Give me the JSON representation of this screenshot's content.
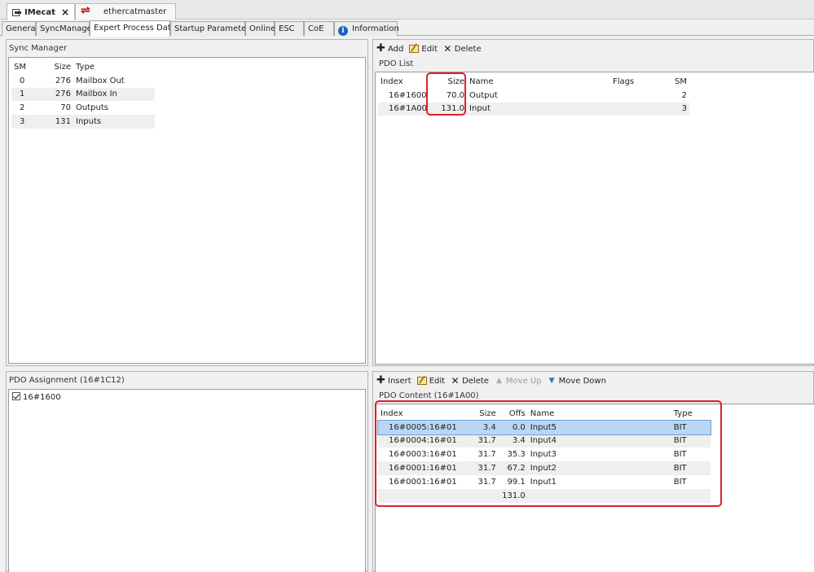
{
  "doc_tabs": [
    {
      "label": "IMecat",
      "active": true
    },
    {
      "label": "ethercatmaster",
      "active": false
    }
  ],
  "editor_tabs": [
    "General",
    "SyncManager",
    "Expert Process Data",
    "Startup Parameters",
    "Online",
    "ESC",
    "CoE",
    "Information"
  ],
  "active_editor_tab": "Expert Process Data",
  "sync_manager": {
    "title": "Sync Manager",
    "headers": [
      "SM",
      "Size",
      "Type"
    ],
    "rows": [
      [
        "0",
        "276",
        "Mailbox Out"
      ],
      [
        "1",
        "276",
        "Mailbox In"
      ],
      [
        "2",
        "70",
        "Outputs"
      ],
      [
        "3",
        "131",
        "Inputs"
      ]
    ]
  },
  "pdo_list": {
    "toolbar": {
      "add": "Add",
      "edit": "Edit",
      "delete": "Delete"
    },
    "title": "PDO List",
    "headers": [
      "Index",
      "Size",
      "Name",
      "Flags",
      "SM"
    ],
    "rows": [
      [
        "16#1600",
        "70.0",
        "Output",
        "",
        "2"
      ],
      [
        "16#1A00",
        "131.0",
        "Input",
        "",
        "3"
      ]
    ]
  },
  "pdo_assignment": {
    "title": "PDO Assignment (16#1C12)",
    "items": [
      {
        "label": "16#1600",
        "checked": true
      }
    ]
  },
  "pdo_content": {
    "toolbar": {
      "insert": "Insert",
      "edit": "Edit",
      "delete": "Delete",
      "move_up": "Move Up",
      "move_down": "Move Down"
    },
    "title": "PDO Content (16#1A00)",
    "headers": [
      "Index",
      "Size",
      "Offs",
      "Name",
      "Type"
    ],
    "rows": [
      [
        "16#0005:16#01",
        "3.4",
        "0.0",
        "Input5",
        "BIT"
      ],
      [
        "16#0004:16#01",
        "31.7",
        "3.4",
        "Input4",
        "BIT"
      ],
      [
        "16#0003:16#01",
        "31.7",
        "35.3",
        "Input3",
        "BIT"
      ],
      [
        "16#0001:16#01",
        "31.7",
        "67.2",
        "Input2",
        "BIT"
      ],
      [
        "16#0001:16#01",
        "31.7",
        "99.1",
        "Input1",
        "BIT"
      ]
    ],
    "total": "131.0",
    "selected_row": 0
  },
  "colors": {
    "highlight": "#e0202a",
    "selection": "#b9d7f5"
  },
  "icons": {
    "device": "device-icon",
    "ethernet": "ethercat-master-icon",
    "info": "info-icon",
    "add": "plus-icon",
    "edit": "edit-icon",
    "delete": "delete-x-icon",
    "up": "arrow-up-icon",
    "down": "arrow-down-icon",
    "check": "checkbox-icon"
  }
}
